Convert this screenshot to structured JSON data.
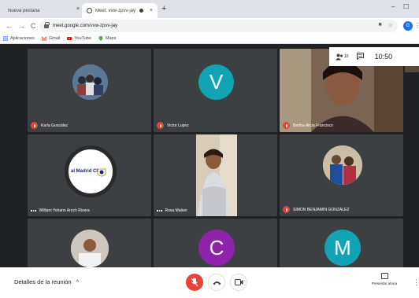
{
  "browser": {
    "tabs": [
      {
        "title": "Nueva pestaña",
        "close": "×"
      },
      {
        "title": "Meet: vvw-zpvv-jay",
        "close": "×"
      }
    ],
    "new_tab": "+",
    "window_controls": {
      "minimize": "–",
      "maximize": "☐"
    },
    "nav": {
      "back": "←",
      "forward": "→",
      "reload": "C"
    },
    "url": "meet.google.com/vvw-zpvv-jay",
    "profile_initial": "G",
    "bookmarks": [
      {
        "label": "Aplicaciones",
        "icon": "apps-grid-icon"
      },
      {
        "label": "Gmail",
        "icon": "gmail-icon"
      },
      {
        "label": "YouTube",
        "icon": "youtube-icon"
      },
      {
        "label": "Maps",
        "icon": "maps-icon"
      }
    ]
  },
  "meeting": {
    "top_bar": {
      "people_count": "10",
      "time": "10:50"
    },
    "participants": [
      {
        "name": "Karla González",
        "muted": true,
        "avatar_type": "photo"
      },
      {
        "name": "Victor Lopez",
        "muted": true,
        "avatar_type": "letter",
        "initial": "V",
        "color": "#12a4b4"
      },
      {
        "name": "Bertha Alicia Francisco",
        "muted": true,
        "avatar_type": "video"
      },
      {
        "name": "William Yohann Aroch Rivera",
        "muted": false,
        "avatar_type": "logo",
        "logo_text": "al Madrid CF"
      },
      {
        "name": "Rosa Matian",
        "muted": false,
        "avatar_type": "video"
      },
      {
        "name": "SIMON BENJAMIN GONZALEZ",
        "muted": true,
        "avatar_type": "photo"
      },
      {
        "name": "",
        "muted": false,
        "avatar_type": "photo"
      },
      {
        "name": "",
        "muted": false,
        "avatar_type": "letter",
        "initial": "C",
        "color": "#8e24aa"
      },
      {
        "name": "",
        "muted": false,
        "avatar_type": "letter",
        "initial": "M",
        "color": "#12a4b4"
      }
    ]
  },
  "controls": {
    "details_label": "Detalles de la reunión",
    "details_chevron": "^",
    "present_label": "Presentar ahora",
    "more": "⋮"
  },
  "colors": {
    "meeting_bg": "#202124",
    "tile_bg": "#3c4043",
    "mute_red": "#ea4335",
    "teal_avatar": "#12a4b4",
    "purple_avatar": "#8e24aa"
  }
}
